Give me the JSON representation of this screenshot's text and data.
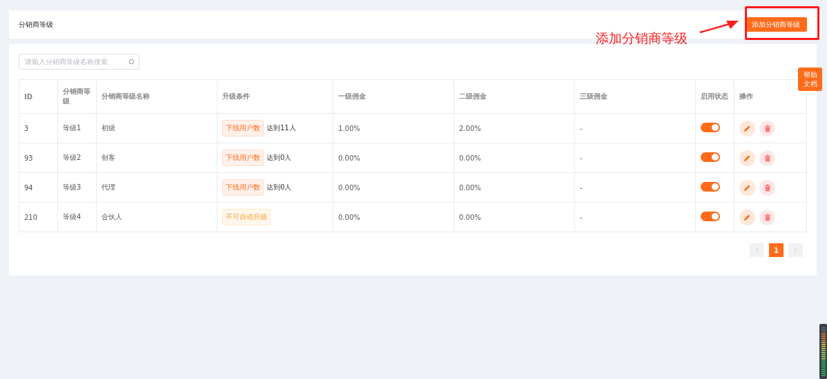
{
  "header": {
    "title": "分销商等级",
    "add_button": "添加分销商等级"
  },
  "annotation": {
    "text": "添加分销商等级"
  },
  "help_button": {
    "line_1": "帮助",
    "line_2": "文档"
  },
  "search": {
    "placeholder": "请输入分销商等级名称搜索"
  },
  "table": {
    "columns": [
      "ID",
      "分销商等级",
      "分销商等级名称",
      "升级条件",
      "一级佣金",
      "二级佣金",
      "三级佣金",
      "启用状态",
      "操作"
    ],
    "rows": [
      {
        "id": "3",
        "level": "等级1",
        "name": "初级",
        "condition": {
          "kind": "downline",
          "tag": "下线用户数",
          "text": "达到11人"
        },
        "commission_1": "1.00%",
        "commission_2": "2.00%",
        "commission_3": "-",
        "enabled": true
      },
      {
        "id": "93",
        "level": "等级2",
        "name": "创客",
        "condition": {
          "kind": "downline",
          "tag": "下线用户数",
          "text": "达到0人"
        },
        "commission_1": "0.00%",
        "commission_2": "0.00%",
        "commission_3": "-",
        "enabled": true
      },
      {
        "id": "94",
        "level": "等级3",
        "name": "代理",
        "condition": {
          "kind": "downline",
          "tag": "下线用户数",
          "text": "达到0人"
        },
        "commission_1": "0.00%",
        "commission_2": "0.00%",
        "commission_3": "-",
        "enabled": true
      },
      {
        "id": "210",
        "level": "等级4",
        "name": "合伙人",
        "condition": {
          "kind": "manual",
          "tag": "不可自动升级"
        },
        "commission_1": "0.00%",
        "commission_2": "0.00%",
        "commission_3": "-",
        "enabled": true
      }
    ]
  },
  "pagination": {
    "pages": [
      {
        "label": "1",
        "selected": true
      }
    ]
  }
}
